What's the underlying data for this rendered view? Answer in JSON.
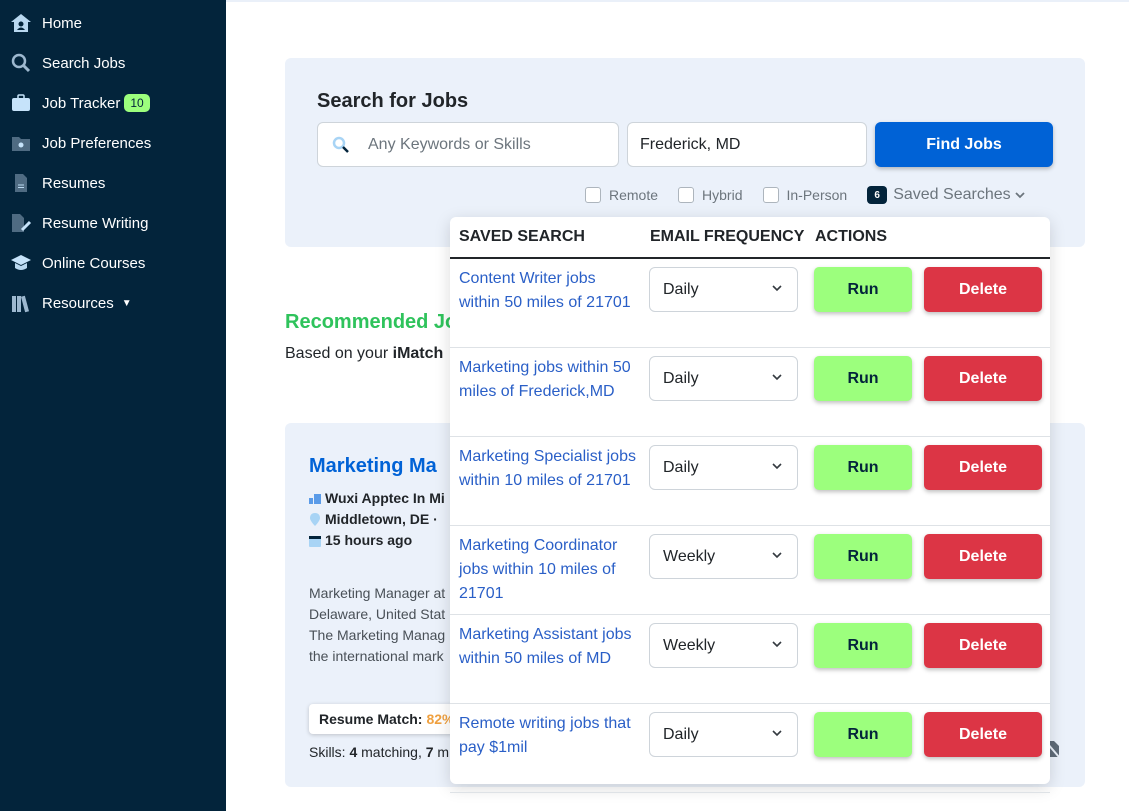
{
  "colors": {
    "sidebar_bg": "#03243b",
    "accent_blue": "#0062d6",
    "run_green": "#9cff7d",
    "delete_red": "#dc3545",
    "recommended_green": "#2fc35c",
    "match_orange": "#f0a140",
    "panel_bg": "#ebf1fa"
  },
  "sidebar": {
    "items": [
      {
        "label": "Home",
        "icon": "home-icon"
      },
      {
        "label": "Search Jobs",
        "icon": "search-icon"
      },
      {
        "label": "Job Tracker",
        "icon": "briefcase-icon",
        "badge": "10"
      },
      {
        "label": "Job Preferences",
        "icon": "folder-gear-icon"
      },
      {
        "label": "Resumes",
        "icon": "document-icon"
      },
      {
        "label": "Resume Writing",
        "icon": "document-pen-icon"
      },
      {
        "label": "Online Courses",
        "icon": "graduation-cap-icon"
      },
      {
        "label": "Resources",
        "icon": "books-icon",
        "has_caret": true
      }
    ]
  },
  "search": {
    "title": "Search for Jobs",
    "keywords_placeholder": "Any Keywords or Skills",
    "keywords_value": "",
    "location_value": "Frederick, MD",
    "find_button": "Find Jobs",
    "filters": [
      {
        "label": "Remote",
        "checked": false
      },
      {
        "label": "Hybrid",
        "checked": false
      },
      {
        "label": "In-Person",
        "checked": false
      }
    ],
    "saved_searches_count": "6",
    "saved_searches_label": "Saved Searches"
  },
  "saved_searches": {
    "headers": {
      "name": "SAVED SEARCH",
      "frequency": "EMAIL FREQUENCY",
      "actions": "ACTIONS"
    },
    "run_label": "Run",
    "delete_label": "Delete",
    "rows": [
      {
        "name": "Content Writer jobs within 50 miles of 21701",
        "frequency": "Daily"
      },
      {
        "name": "Marketing jobs within 50 miles of Frederick,MD",
        "frequency": "Daily"
      },
      {
        "name": "Marketing Specialist jobs within 10 miles of 21701",
        "frequency": "Daily"
      },
      {
        "name": "Marketing Coordinator jobs within 10 miles of 21701",
        "frequency": "Weekly"
      },
      {
        "name": "Marketing Assistant jobs within 50 miles of MD",
        "frequency": "Weekly"
      },
      {
        "name": "Remote writing jobs that pay $1mil",
        "frequency": "Daily"
      }
    ]
  },
  "recommended": {
    "title": "Recommended Jo",
    "subtitle_prefix": "Based on your ",
    "subtitle_bold": "iMatch"
  },
  "job_card": {
    "title": "Marketing Ma",
    "company": "Wuxi Apptec In Mi",
    "location": "Middletown, DE  ·",
    "posted": "15 hours ago",
    "description_lines": [
      "Marketing Manager at",
      "Delaware, United Stat",
      "The Marketing Manag",
      "the international mark"
    ],
    "resume_match_label": "Resume Match:",
    "resume_match_value": "82%",
    "skills_prefix": "Skills: ",
    "skills_matching": "4",
    "skills_matching_label": " matching, ",
    "skills_missing": "7",
    "skills_missing_label": " m"
  }
}
